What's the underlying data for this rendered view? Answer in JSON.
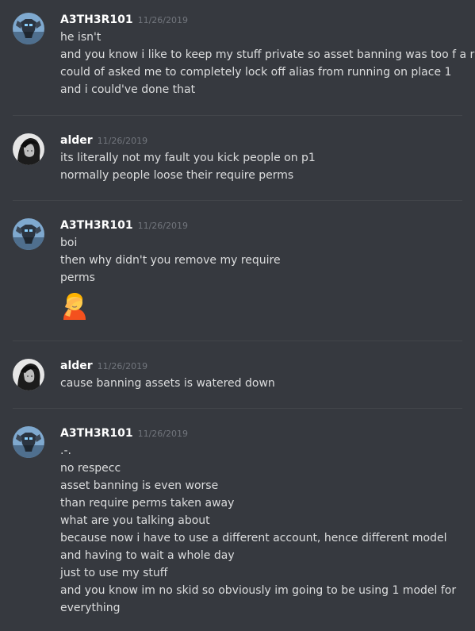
{
  "messages": [
    {
      "author": "A3TH3R101",
      "timestamp": "11/26/2019",
      "avatar_icon": "robot-mech-avatar",
      "lines": [
        "he isn't",
        "and you know i like to keep my stuff private so asset banning was too f a r",
        "could of asked me to completely lock off alias from running on place 1",
        "and i could've done that"
      ]
    },
    {
      "author": "alder",
      "timestamp": "11/26/2019",
      "avatar_icon": "dark-hair-portrait-avatar",
      "lines": [
        "its literally not my fault you kick people on p1",
        "normally people loose their require perms"
      ]
    },
    {
      "author": "A3TH3R101",
      "timestamp": "11/26/2019",
      "avatar_icon": "robot-mech-avatar",
      "lines": [
        "boi",
        "then why didn't you remove my require",
        "perms"
      ],
      "emoji": "person-facepalming-emoji"
    },
    {
      "author": "alder",
      "timestamp": "11/26/2019",
      "avatar_icon": "dark-hair-portrait-avatar",
      "lines": [
        "cause banning assets is watered down"
      ]
    },
    {
      "author": "A3TH3R101",
      "timestamp": "11/26/2019",
      "avatar_icon": "robot-mech-avatar",
      "lines": [
        ".-.",
        "no respecc",
        "asset banning is even worse",
        "than require perms taken away",
        "what are you talking about",
        "because now i have to use a different account, hence different model",
        "and having to wait a whole day",
        "just to use my stuff",
        "and you know im no skid so obviously im going to be using 1 model for",
        "everything"
      ]
    }
  ]
}
